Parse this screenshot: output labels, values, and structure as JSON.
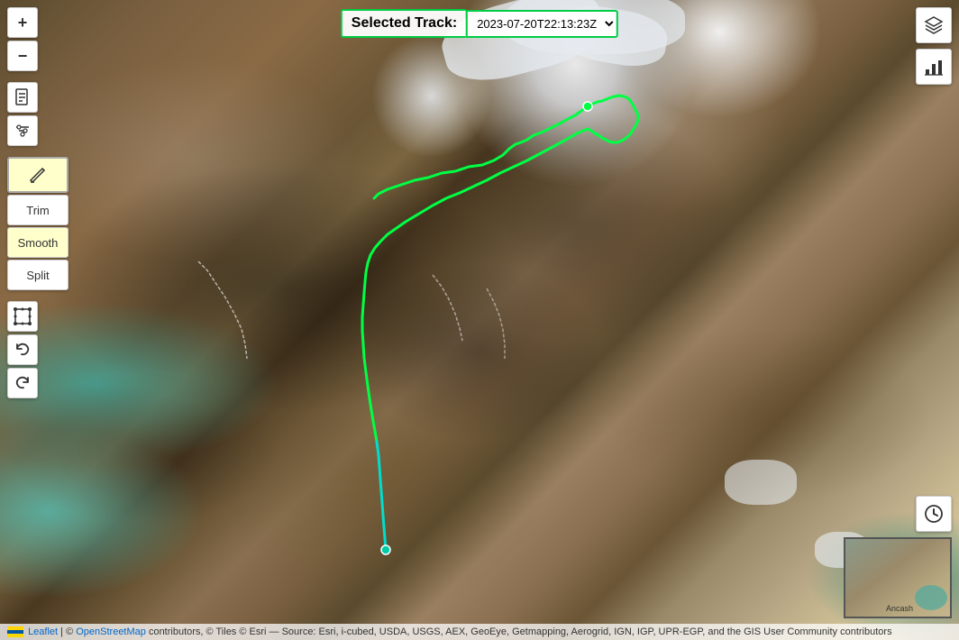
{
  "header": {
    "selected_track_label": "Selected Track:",
    "track_date": "2023-07-20T22:13:23Z"
  },
  "toolbar_left": {
    "zoom_in": "+",
    "zoom_out": "−",
    "document_icon": "📄",
    "settings_icon": "⚙",
    "edit_icon": "✏",
    "trim_label": "Trim",
    "smooth_label": "Smooth",
    "split_label": "Split",
    "select_icon": "⬚",
    "undo_icon": "↩",
    "redo_icon": "↪"
  },
  "toolbar_right": {
    "layers_icon": "layers",
    "chart_icon": "chart"
  },
  "attribution": {
    "leaflet_text": "Leaflet",
    "osm_text": "© OpenStreetMap contributors, © Tiles © Esri — Source: Esri, i-cubed, USDA, USGS, AEX, GeoEye, Getmapping, Aerogrid, IGN, IGP, UPR-EGP, and the GIS User Community contributors"
  },
  "minimap": {
    "location": "Ancash"
  },
  "colors": {
    "track_green": "#00ff44",
    "track_cyan": "#00ffcc",
    "header_border": "#00cc44"
  }
}
